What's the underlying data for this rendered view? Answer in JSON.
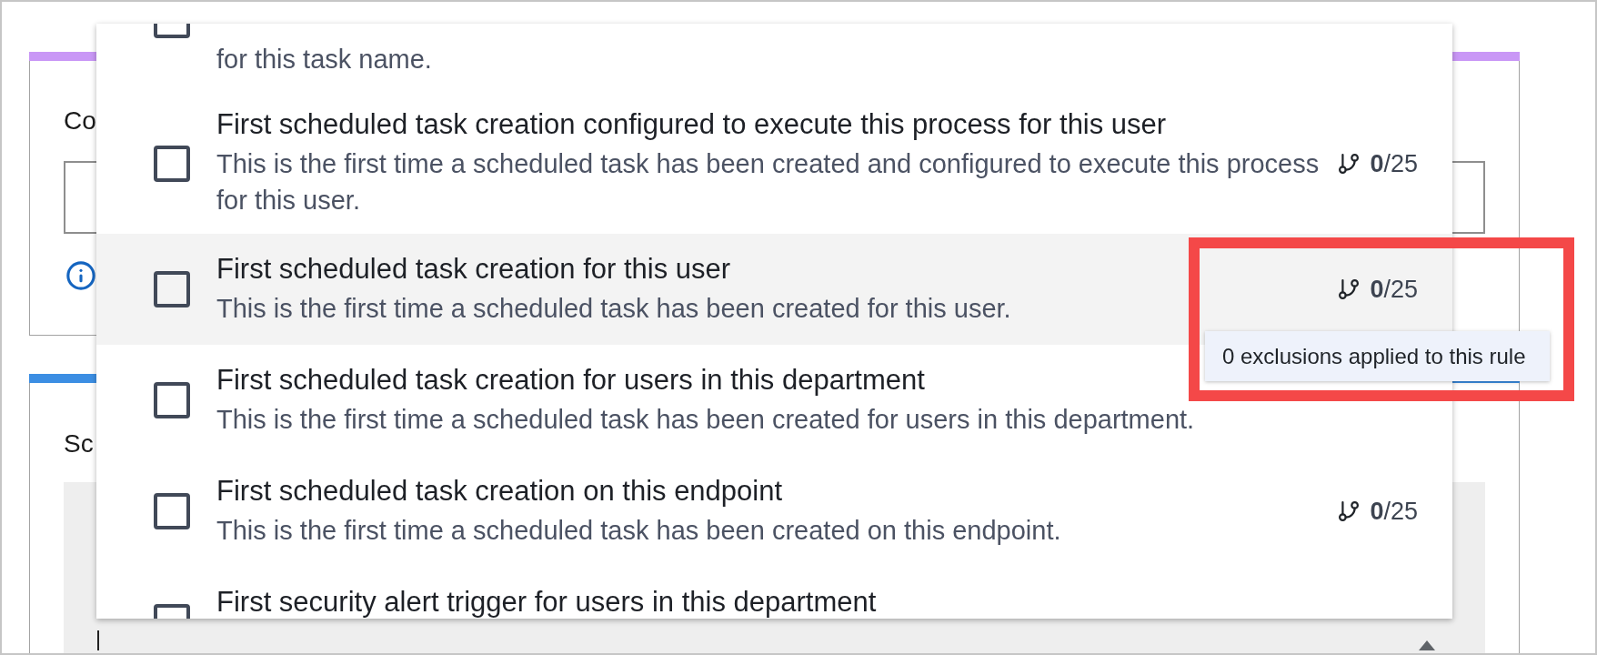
{
  "cards": [
    {
      "kind": "input",
      "title": "Co",
      "color": "#c997f6"
    },
    {
      "kind": "editor",
      "title": "Sc",
      "color": "#3c8ee3"
    }
  ],
  "dropdown": {
    "items": [
      {
        "description": "for this task name.",
        "checked": false,
        "highlighted": false
      },
      {
        "title": "First scheduled task creation configured to execute this process for this user",
        "description": "This is the first time a scheduled task has been created and configured to execute this process for this user.",
        "count": "**0**/25",
        "checked": false,
        "highlighted": false
      },
      {
        "title": "First scheduled task creation for this user",
        "description": "This is the first time a scheduled task has been created for this user.",
        "count": "**0**/25",
        "checked": false,
        "highlighted": true
      },
      {
        "title": "First scheduled task creation for users in this department",
        "description": "This is the first time a scheduled task has been created for users in this department.",
        "checked": false,
        "highlighted": false
      },
      {
        "title": "First scheduled task creation on this endpoint",
        "description": "This is the first time a scheduled task has been created on this endpoint.",
        "count": "**0**/25",
        "checked": false,
        "highlighted": false
      },
      {
        "title": "First security alert trigger for users in this department",
        "checked": false,
        "highlighted": false
      }
    ]
  },
  "tooltip": {
    "text": "0 exclusions applied to this rule"
  },
  "annotation": {
    "kind": "rectangle"
  }
}
